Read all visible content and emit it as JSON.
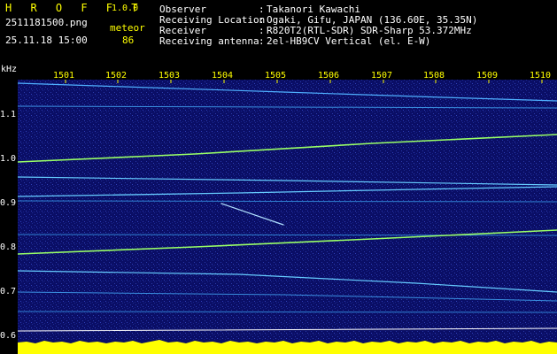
{
  "header": {
    "app_name": "H R O F F T",
    "version": "1.0.0",
    "filename": "2511181500.png",
    "meteor_label": "meteor",
    "datetime": "25.11.18 15:00",
    "meteor_count": "86"
  },
  "info": [
    {
      "label": "Observer",
      "value": "Takanori Kawachi"
    },
    {
      "label": "Receiving Location",
      "value": "Ogaki, Gifu, JAPAN (136.60E, 35.35N)"
    },
    {
      "label": "Receiver",
      "value": "R820T2(RTL-SDR) SDR-Sharp 53.372MHz"
    },
    {
      "label": "Receiving antenna",
      "value": "2el-HB9CV Vertical (el. E-W)"
    }
  ],
  "axis": {
    "y_unit": "kHz",
    "y_ticks": [
      "1.1",
      "1.0",
      "0.9",
      "0.8",
      "0.7",
      "0.6"
    ],
    "x_ticks": [
      "1501",
      "1502",
      "1503",
      "1504",
      "1505",
      "1506",
      "1507",
      "1508",
      "1509",
      "1510"
    ]
  },
  "colors": {
    "background": "#000000",
    "plot_bg": "#0a0e66",
    "signal": "#66ccff",
    "strong_signal": "#99ff66",
    "text_header": "#ffff00",
    "text_info": "#ffffff",
    "amplitude": "#ffff00"
  }
}
